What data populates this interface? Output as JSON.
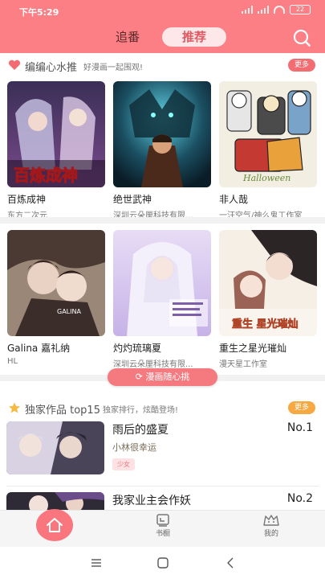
{
  "status_bar": {
    "time": "下午5:29",
    "battery": "22"
  },
  "header": {
    "tabs": [
      {
        "label": "追番",
        "active": false
      },
      {
        "label": "推荐",
        "active": true
      }
    ],
    "icon": "search-icon"
  },
  "editor_picks": {
    "icon": "heart-icon",
    "title": "编编心水推",
    "subtitle": "好漫画一起围观!",
    "more_label": "更多",
    "items": [
      {
        "name": "百炼成神",
        "author": "东方二次元",
        "cover_text": "百炼成神"
      },
      {
        "name": "绝世武神",
        "author": "深圳云朵厘科技有限..."
      },
      {
        "name": "非人哉",
        "author": "一汪空气/神么鬼工作室",
        "cover_text": "Halloween"
      },
      {
        "name": "Galina 嘉礼纳",
        "author": "HL",
        "cover_text": "GALINA"
      },
      {
        "name": "灼灼琉璃夏",
        "author": "深圳云朵厘科技有限..."
      },
      {
        "name": "重生之星光璀灿",
        "author": "漫天星工作室",
        "cover_text": "重生 星光璀灿"
      }
    ],
    "random_button": "漫画随心挑"
  },
  "exclusive": {
    "icon": "star-icon",
    "title": "独家作品 top15",
    "subtitle": "独家排行，炫酷登场!",
    "more_label": "更多",
    "items": [
      {
        "name": "雨后的盛夏",
        "rank": "No.1",
        "author": "小林很幸运",
        "tag": "少女"
      },
      {
        "name": "我家业主会作妖",
        "rank": "No.2"
      }
    ]
  },
  "bottom_nav": {
    "items": [
      {
        "label": "",
        "icon": "home-icon"
      },
      {
        "label": "书橱",
        "icon": "bookshelf-icon"
      },
      {
        "label": "我的",
        "icon": "profile-icon"
      }
    ]
  },
  "colors": {
    "brand": "#fb7f85",
    "accent": "#f47a80",
    "more_red": "#f26c72",
    "more_orange": "#f6a942"
  }
}
